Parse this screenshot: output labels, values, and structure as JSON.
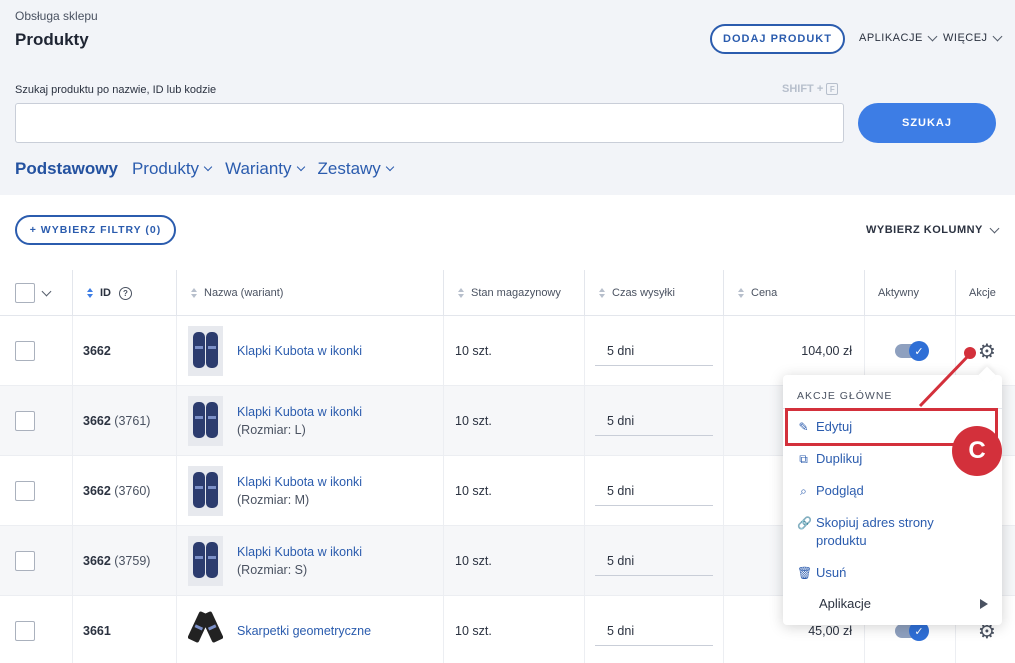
{
  "header": {
    "breadcrumb": "Obsługa sklepu",
    "title": "Produkty",
    "add_product": "DODAJ PRODUKT",
    "apps_menu": "APLIKACJE",
    "more_menu": "WIĘCEJ"
  },
  "search": {
    "label": "Szukaj produktu po nazwie, ID lub kodzie",
    "shortcut": "SHIFT +",
    "shortcut_key": "F",
    "value": "",
    "button": "SZUKAJ"
  },
  "tabs": [
    {
      "label": "Podstawowy",
      "active": true
    },
    {
      "label": "Produkty"
    },
    {
      "label": "Warianty"
    },
    {
      "label": "Zestawy"
    }
  ],
  "toolbar": {
    "filters": "+ WYBIERZ FILTRY (0)",
    "columns": "WYBIERZ KOLUMNY"
  },
  "table": {
    "headers": {
      "id": "ID",
      "name": "Nazwa (wariant)",
      "stock": "Stan magazynowy",
      "shipping": "Czas wysyłki",
      "price": "Cena",
      "active": "Aktywny",
      "actions": "Akcje"
    },
    "rows": [
      {
        "id": "3662",
        "variant_id": "",
        "name": "Klapki Kubota w ikonki",
        "variant": "",
        "stock": "10 szt.",
        "shipping": "5 dni",
        "price": "104,00 zł",
        "active": true
      },
      {
        "id": "3662",
        "variant_id": "(3761)",
        "name": "Klapki Kubota w ikonki",
        "variant": "(Rozmiar: L)",
        "stock": "10 szt.",
        "shipping": "5 dni",
        "price": "",
        "active": true
      },
      {
        "id": "3662",
        "variant_id": "(3760)",
        "name": "Klapki Kubota w ikonki",
        "variant": "(Rozmiar: M)",
        "stock": "10 szt.",
        "shipping": "5 dni",
        "price": "",
        "active": true
      },
      {
        "id": "3662",
        "variant_id": "(3759)",
        "name": "Klapki Kubota w ikonki",
        "variant": "(Rozmiar: S)",
        "stock": "10 szt.",
        "shipping": "5 dni",
        "price": "",
        "active": true
      },
      {
        "id": "3661",
        "variant_id": "",
        "name": "Skarpetki geometryczne",
        "variant": "",
        "stock": "10 szt.",
        "shipping": "5 dni",
        "price": "45,00 zł",
        "active": true
      }
    ]
  },
  "actions_menu": {
    "heading": "AKCJE GŁÓWNE",
    "edit": "Edytuj",
    "duplicate": "Duplikuj",
    "preview": "Podgląd",
    "copy_url": "Skopiuj adres strony produktu",
    "delete": "Usuń",
    "apps": "Aplikacje"
  },
  "annotation": {
    "label": "C",
    "color": "#d3303b"
  }
}
